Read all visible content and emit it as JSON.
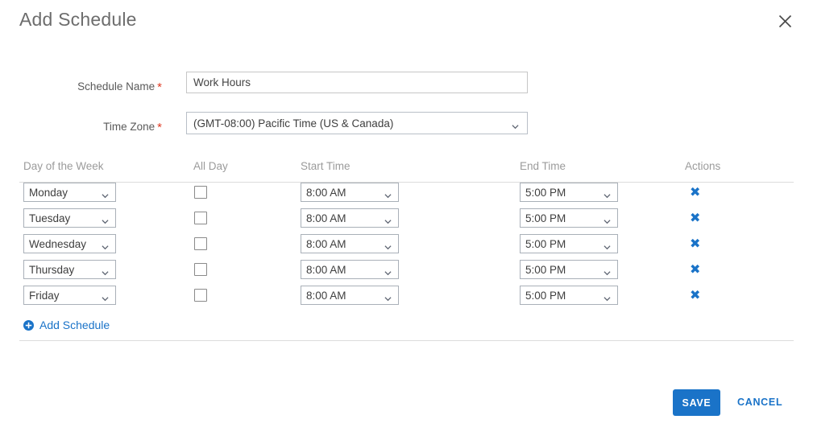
{
  "dialog": {
    "title": "Add Schedule",
    "close_icon": "close-icon"
  },
  "form": {
    "schedule_name": {
      "label": "Schedule Name",
      "required_marker": "*",
      "value": "Work Hours",
      "placeholder": ""
    },
    "time_zone": {
      "label": "Time Zone",
      "required_marker": "*",
      "value": "(GMT-08:00) Pacific Time (US & Canada)"
    }
  },
  "table": {
    "headers": {
      "day": "Day of the Week",
      "all_day": "All Day",
      "start_time": "Start Time",
      "end_time": "End Time",
      "actions": "Actions"
    },
    "rows": [
      {
        "day": "Monday",
        "all_day": false,
        "start_time": "8:00 AM",
        "end_time": "5:00 PM",
        "delete_icon": "delete-icon"
      },
      {
        "day": "Tuesday",
        "all_day": false,
        "start_time": "8:00 AM",
        "end_time": "5:00 PM",
        "delete_icon": "delete-icon"
      },
      {
        "day": "Wednesday",
        "all_day": false,
        "start_time": "8:00 AM",
        "end_time": "5:00 PM",
        "delete_icon": "delete-icon"
      },
      {
        "day": "Thursday",
        "all_day": false,
        "start_time": "8:00 AM",
        "end_time": "5:00 PM",
        "delete_icon": "delete-icon"
      },
      {
        "day": "Friday",
        "all_day": false,
        "start_time": "8:00 AM",
        "end_time": "5:00 PM",
        "delete_icon": "delete-icon"
      }
    ]
  },
  "add_link": {
    "label": "Add Schedule",
    "icon": "plus-circle-icon"
  },
  "footer": {
    "save_label": "SAVE",
    "cancel_label": "CANCEL"
  },
  "colors": {
    "accent_blue": "#1a73c8",
    "required_red": "#e03b24",
    "title_gray": "#6d6d6d",
    "header_gray": "#9b9b9b",
    "border_gray": "#c6c6c6"
  }
}
